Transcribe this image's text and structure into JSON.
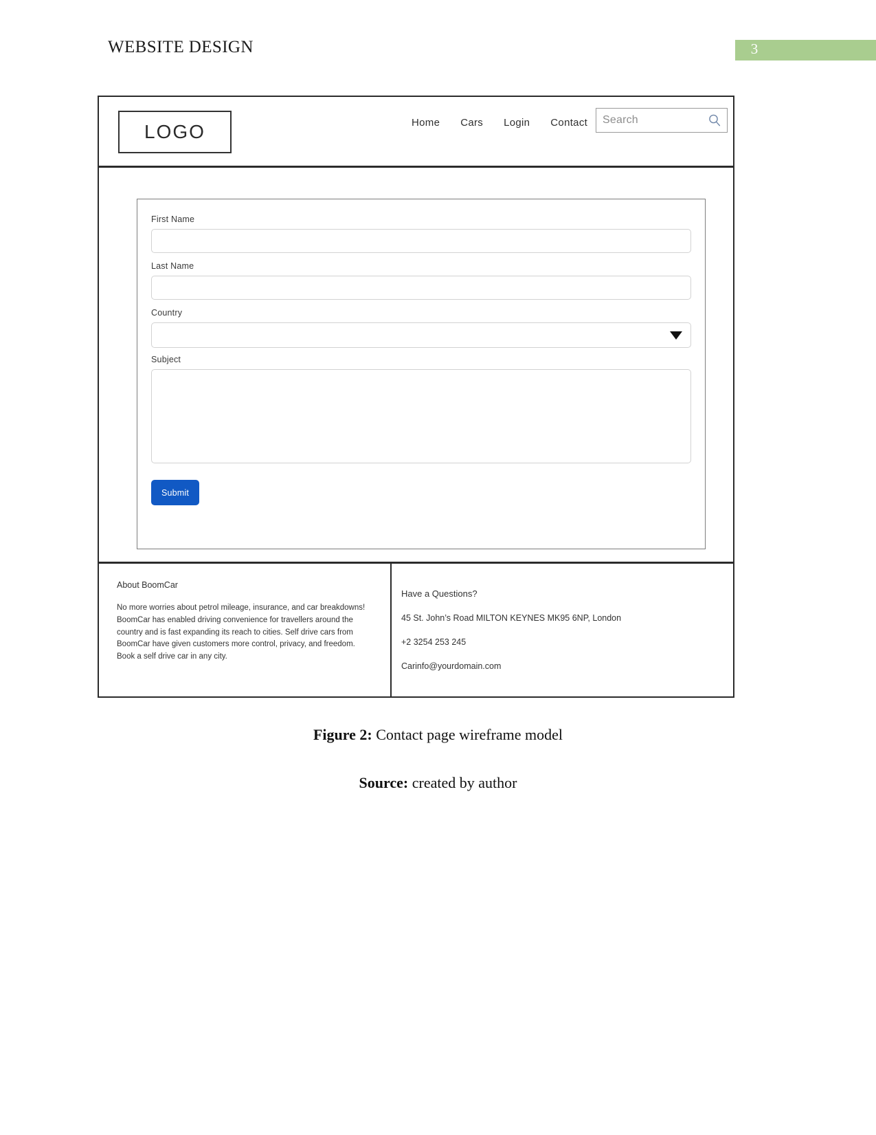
{
  "document": {
    "running_head": "WEBSITE DESIGN",
    "page_number": "3",
    "page_number_color": "#a9cd8f"
  },
  "wireframe": {
    "nav": {
      "logo": "LOGO",
      "links": [
        {
          "label": "Home"
        },
        {
          "label": "Cars"
        },
        {
          "label": "Login"
        },
        {
          "label": "Contact"
        }
      ],
      "search": {
        "placeholder": "Search",
        "value": "",
        "icon": "search-icon"
      }
    },
    "form": {
      "fields": [
        {
          "label": "First Name",
          "type": "text",
          "value": "",
          "placeholder": ""
        },
        {
          "label": "Last Name",
          "type": "text",
          "value": "",
          "placeholder": ""
        },
        {
          "label": "Country",
          "type": "select",
          "value": "",
          "placeholder": "",
          "icon": "chevron-down-icon"
        },
        {
          "label": "Subject",
          "type": "textarea",
          "value": "",
          "placeholder": ""
        }
      ],
      "submit_label": "Submit",
      "submit_color": "#1159c4"
    },
    "footer": {
      "left": {
        "heading": "About BoomCar",
        "body": "No more worries about petrol mileage, insurance, and car breakdowns! BoomCar has enabled driving convenience for travellers around the country and is fast expanding its reach to cities. Self drive cars from BoomCar have given customers more control, privacy, and freedom. Book a self drive car in any city."
      },
      "right": {
        "heading": "Have a Questions?",
        "address": "45 St. John’s Road MILTON KEYNES MK95 6NP, London",
        "phone": "+2 3254 253 245",
        "email": "Carinfo@yourdomain.com"
      }
    }
  },
  "caption": {
    "figure_label": "Figure 2:",
    "figure_text": " Contact page wireframe model",
    "source_label": "Source:",
    "source_text": " created by author"
  }
}
